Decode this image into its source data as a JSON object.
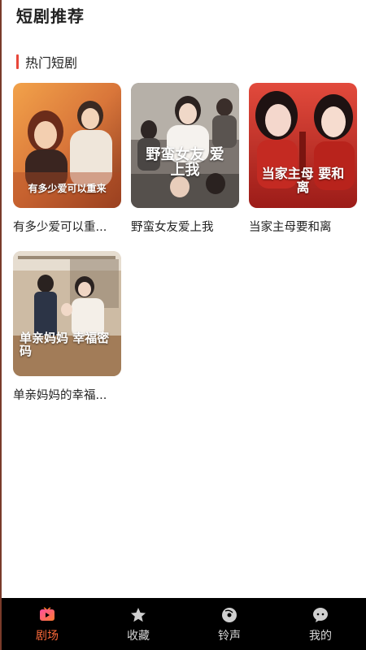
{
  "header": {
    "title": "短剧推荐"
  },
  "section": {
    "title": "热门短剧"
  },
  "dramas": [
    {
      "title": "有多少爱可以重...",
      "cover_text": "有多少爱可以重来"
    },
    {
      "title": "野蛮女友爱上我",
      "cover_text": "野蛮女友 爱上我"
    },
    {
      "title": "当家主母要和离",
      "cover_text": "当家主母 要和离"
    },
    {
      "title": "单亲妈妈的幸福...",
      "cover_text": "单亲妈妈 幸福密码"
    }
  ],
  "tabbar": {
    "tabs": [
      {
        "label": "剧场",
        "icon": "play-screen-icon",
        "active": true
      },
      {
        "label": "收藏",
        "icon": "star-icon",
        "active": false
      },
      {
        "label": "铃声",
        "icon": "music-disc-icon",
        "active": false
      },
      {
        "label": "我的",
        "icon": "chat-profile-icon",
        "active": false
      }
    ]
  },
  "colors": {
    "accent": "#ff6a3a",
    "section_bar": "#e8473a",
    "tabbar_bg": "#000000"
  }
}
